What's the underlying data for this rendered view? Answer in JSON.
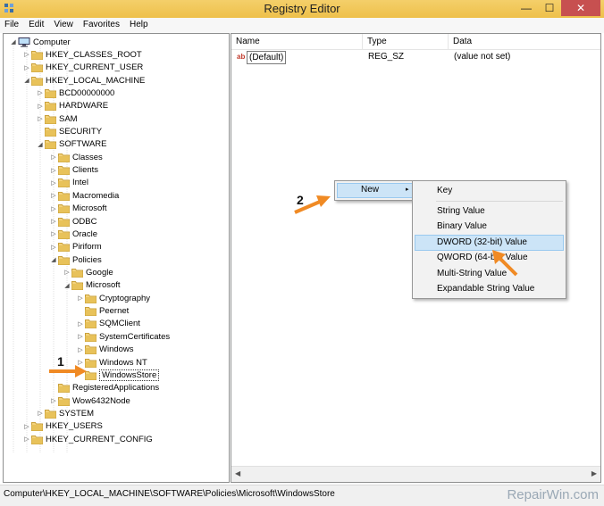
{
  "window": {
    "title": "Registry Editor",
    "minimize": "—",
    "maximize": "☐",
    "close": "✕"
  },
  "menu": [
    "File",
    "Edit",
    "View",
    "Favorites",
    "Help"
  ],
  "tree": {
    "root": "Computer",
    "nodes": [
      {
        "label": "HKEY_CLASSES_ROOT",
        "depth": 1,
        "expander": "▷"
      },
      {
        "label": "HKEY_CURRENT_USER",
        "depth": 1,
        "expander": "▷"
      },
      {
        "label": "HKEY_LOCAL_MACHINE",
        "depth": 1,
        "expander": "◢"
      },
      {
        "label": "BCD00000000",
        "depth": 2,
        "expander": "▷"
      },
      {
        "label": "HARDWARE",
        "depth": 2,
        "expander": "▷"
      },
      {
        "label": "SAM",
        "depth": 2,
        "expander": "▷"
      },
      {
        "label": "SECURITY",
        "depth": 2,
        "expander": ""
      },
      {
        "label": "SOFTWARE",
        "depth": 2,
        "expander": "◢"
      },
      {
        "label": "Classes",
        "depth": 3,
        "expander": "▷"
      },
      {
        "label": "Clients",
        "depth": 3,
        "expander": "▷"
      },
      {
        "label": "Intel",
        "depth": 3,
        "expander": "▷"
      },
      {
        "label": "Macromedia",
        "depth": 3,
        "expander": "▷"
      },
      {
        "label": "Microsoft",
        "depth": 3,
        "expander": "▷"
      },
      {
        "label": "ODBC",
        "depth": 3,
        "expander": "▷"
      },
      {
        "label": "Oracle",
        "depth": 3,
        "expander": "▷"
      },
      {
        "label": "Piriform",
        "depth": 3,
        "expander": "▷"
      },
      {
        "label": "Policies",
        "depth": 3,
        "expander": "◢"
      },
      {
        "label": "Google",
        "depth": 4,
        "expander": "▷"
      },
      {
        "label": "Microsoft",
        "depth": 4,
        "expander": "◢"
      },
      {
        "label": "Cryptography",
        "depth": 5,
        "expander": "▷"
      },
      {
        "label": "Peernet",
        "depth": 5,
        "expander": ""
      },
      {
        "label": "SQMClient",
        "depth": 5,
        "expander": "▷"
      },
      {
        "label": "SystemCertificates",
        "depth": 5,
        "expander": "▷"
      },
      {
        "label": "Windows",
        "depth": 5,
        "expander": "▷"
      },
      {
        "label": "Windows NT",
        "depth": 5,
        "expander": "▷"
      },
      {
        "label": "WindowsStore",
        "depth": 5,
        "expander": "",
        "selected": true
      },
      {
        "label": "RegisteredApplications",
        "depth": 3,
        "expander": ""
      },
      {
        "label": "Wow6432Node",
        "depth": 3,
        "expander": "▷"
      },
      {
        "label": "SYSTEM",
        "depth": 2,
        "expander": "▷"
      },
      {
        "label": "HKEY_USERS",
        "depth": 1,
        "expander": "▷"
      },
      {
        "label": "HKEY_CURRENT_CONFIG",
        "depth": 1,
        "expander": "▷"
      }
    ]
  },
  "columns": {
    "name": "Name",
    "type": "Type",
    "data": "Data"
  },
  "values": [
    {
      "icon": "ab",
      "name": "(Default)",
      "type": "REG_SZ",
      "data": "(value not set)"
    }
  ],
  "context_menu": {
    "new_label": "New",
    "arrow": "▸"
  },
  "submenu": {
    "key": "Key",
    "items": [
      "String Value",
      "Binary Value",
      "DWORD (32-bit) Value",
      "QWORD (64-bit) Value",
      "Multi-String Value",
      "Expandable String Value"
    ]
  },
  "status_path": "Computer\\HKEY_LOCAL_MACHINE\\SOFTWARE\\Policies\\Microsoft\\WindowsStore",
  "watermark": "RepairWin.com",
  "annotations": {
    "step1": "1",
    "step2": "2"
  },
  "colors": {
    "accent_arrow": "#f08a24",
    "highlight": "#cce4f7",
    "folder": "#e8c25a"
  }
}
